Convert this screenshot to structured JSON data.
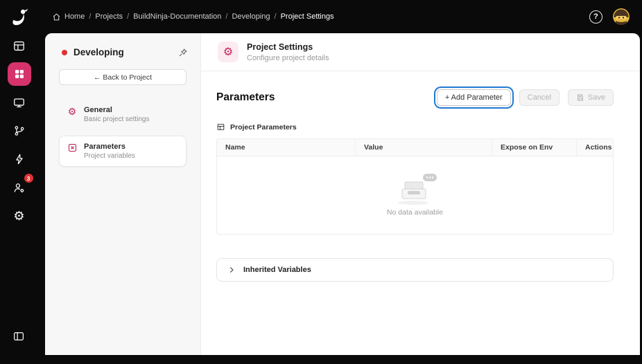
{
  "topbar": {
    "breadcrumb": [
      "Home",
      "Projects",
      "BuildNinja-Documentation",
      "Developing",
      "Project Settings"
    ],
    "separator": "/",
    "help_label": "?"
  },
  "rail": {
    "notifications_badge": "3"
  },
  "sidebar": {
    "project_name": "Developing",
    "back_button_label": "← Back to Project",
    "items": [
      {
        "label": "General",
        "subtitle": "Basic project settings"
      },
      {
        "label": "Parameters",
        "subtitle": "Project variables"
      }
    ]
  },
  "main": {
    "header_title": "Project Settings",
    "header_subtitle": "Configure project details",
    "section_title": "Parameters",
    "add_button_label": "+ Add Parameter",
    "cancel_button_label": "Cancel",
    "save_button_label": "Save",
    "group_label": "Project Parameters",
    "table": {
      "headers": [
        "Name",
        "Value",
        "Expose on Env",
        "Actions"
      ],
      "rows": [],
      "empty_text": "No data available"
    },
    "inherited_panel_label": "Inherited Variables"
  },
  "colors": {
    "accent": "#d6336c",
    "focus_ring": "#1f7ad4",
    "badge": "#e03131"
  }
}
